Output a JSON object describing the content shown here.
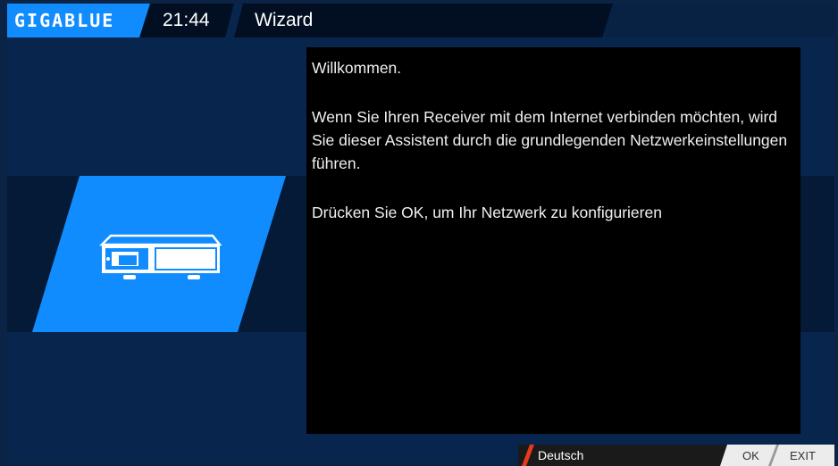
{
  "header": {
    "logo": "GIGABLUE",
    "time": "21:44",
    "title": "Wizard"
  },
  "wizard": {
    "icon": "receiver-icon",
    "paragraphs": [
      "Willkommen.",
      "Wenn Sie Ihren Receiver mit dem Internet verbinden möchten, wird Sie dieser Assistent durch die grundlegenden Netzwerkeinstellungen führen.",
      "Drücken Sie OK, um Ihr Netzwerk zu konfigurieren"
    ]
  },
  "footer": {
    "language": "Deutsch",
    "ok_label": "OK",
    "exit_label": "EXIT"
  },
  "colors": {
    "accent": "#118cff",
    "background": "#08264d",
    "textbox": "#000000",
    "language_marker": "#e43b1c"
  }
}
